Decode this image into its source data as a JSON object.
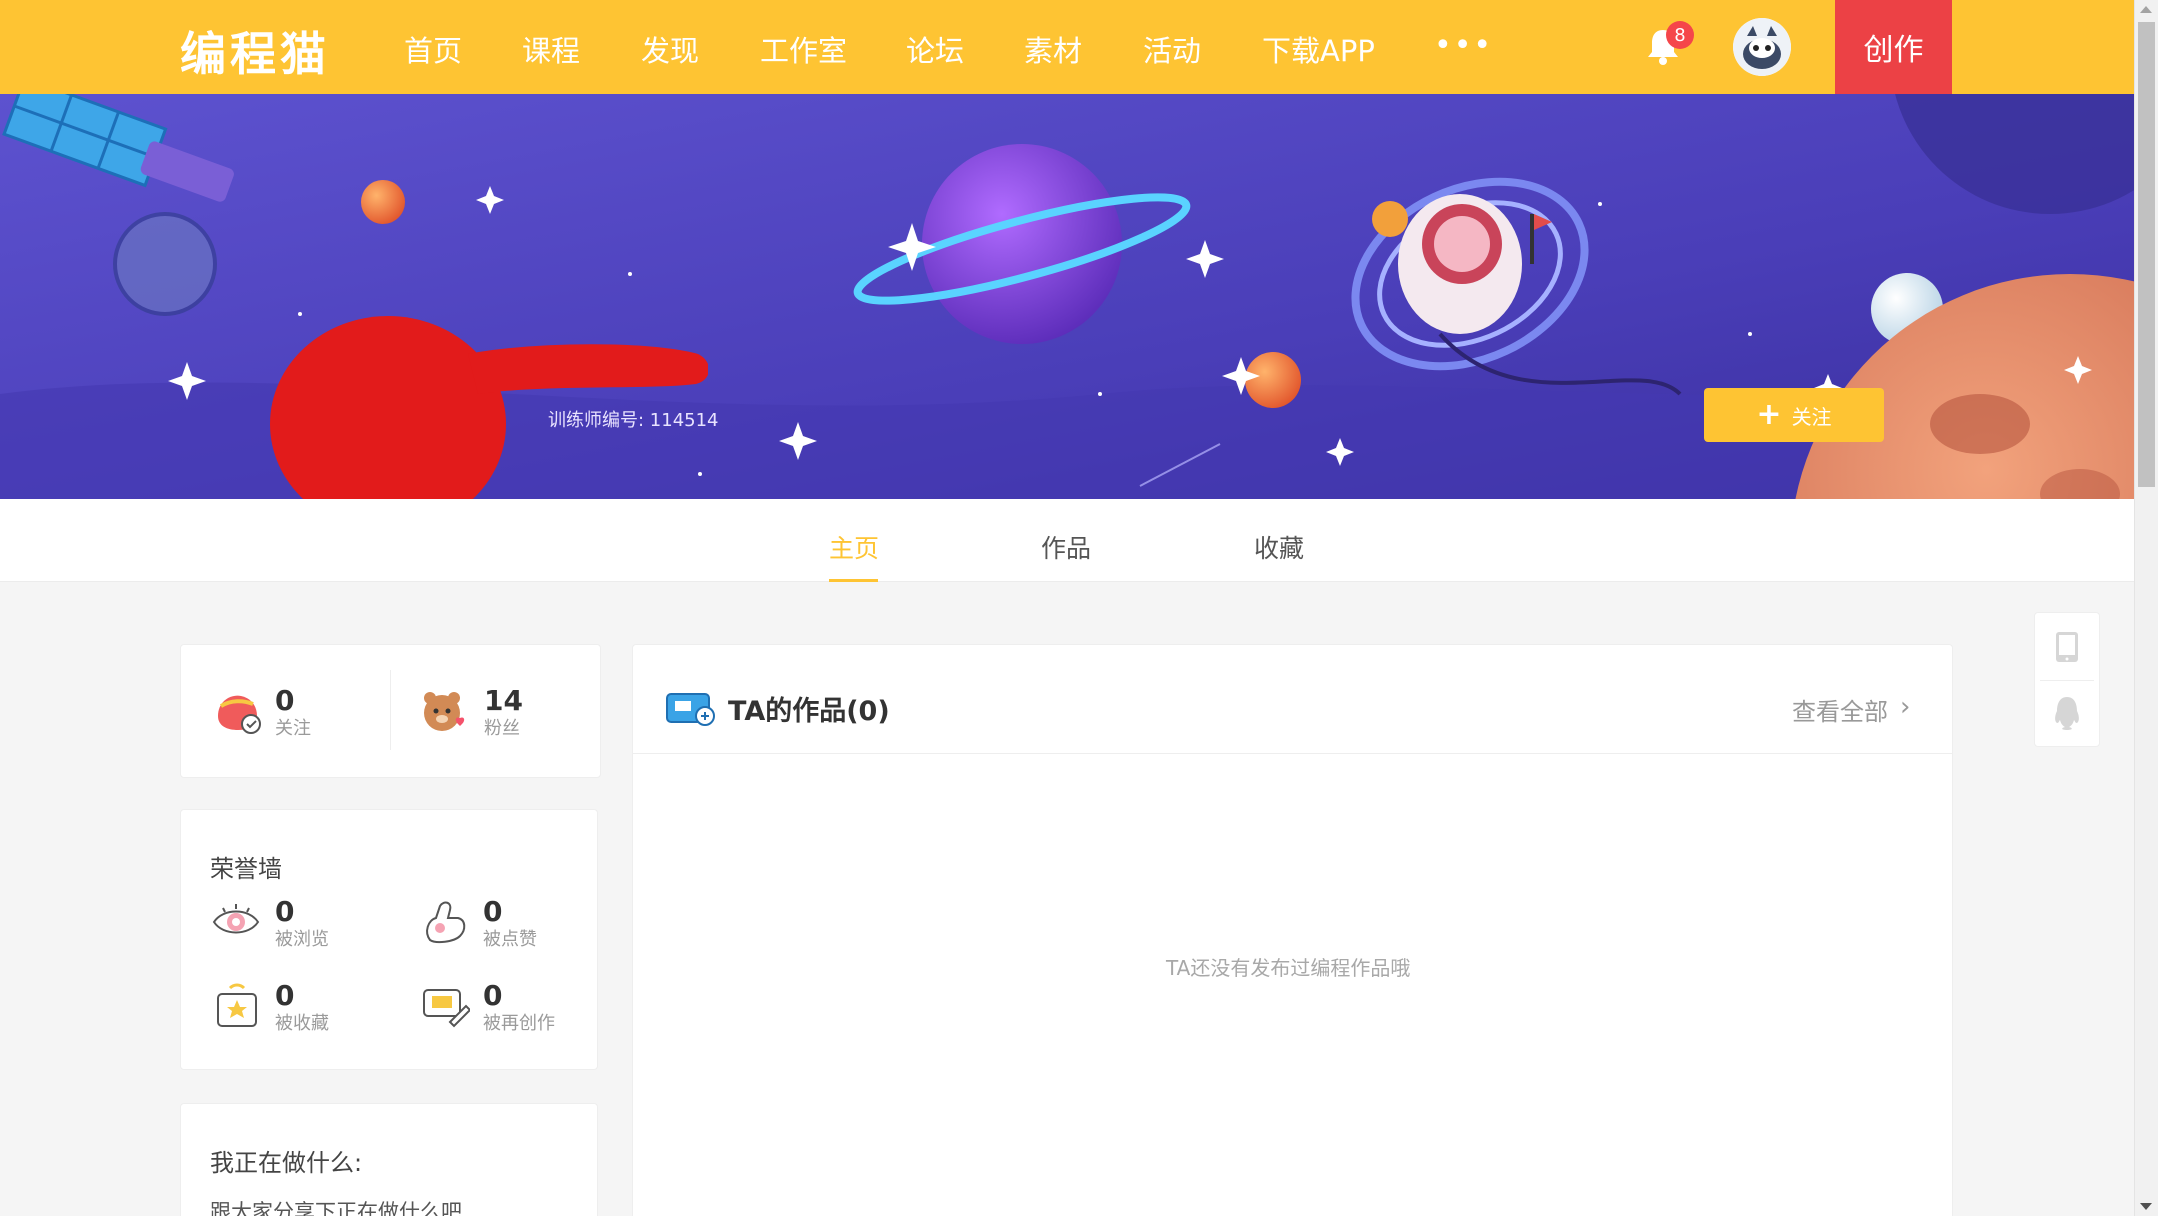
{
  "nav": {
    "logo": "编程猫",
    "items": [
      "首页",
      "课程",
      "发现",
      "工作室",
      "论坛",
      "素材",
      "活动",
      "下载APP"
    ],
    "more": "•••",
    "notification_count": "8",
    "create_label": "创作"
  },
  "profile": {
    "trainer_id": "训练师编号: 114514",
    "follow_label": "关注"
  },
  "tabs": [
    "主页",
    "作品",
    "收藏"
  ],
  "social": {
    "following_count": "0",
    "following_label": "关注",
    "fans_count": "14",
    "fans_label": "粉丝"
  },
  "honor": {
    "title": "荣誉墙",
    "views_count": "0",
    "views_label": "被浏览",
    "likes_count": "0",
    "likes_label": "被点赞",
    "collected_count": "0",
    "collected_label": "被收藏",
    "remix_count": "0",
    "remix_label": "被再创作"
  },
  "status": {
    "title": "我正在做什么:",
    "text": "跟大家分享下正在做什么吧"
  },
  "works": {
    "title": "TA的作品(0)",
    "view_all": "查看全部",
    "empty": "TA还没有发布过编程作品哦"
  },
  "icons": {
    "bell": "bell-icon",
    "tablet": "tablet-icon",
    "qq": "qq-penguin-icon"
  },
  "colors": {
    "brand_yellow": "#fec433",
    "create_red": "#ec4145",
    "banner_purple": "#5a48c8"
  }
}
